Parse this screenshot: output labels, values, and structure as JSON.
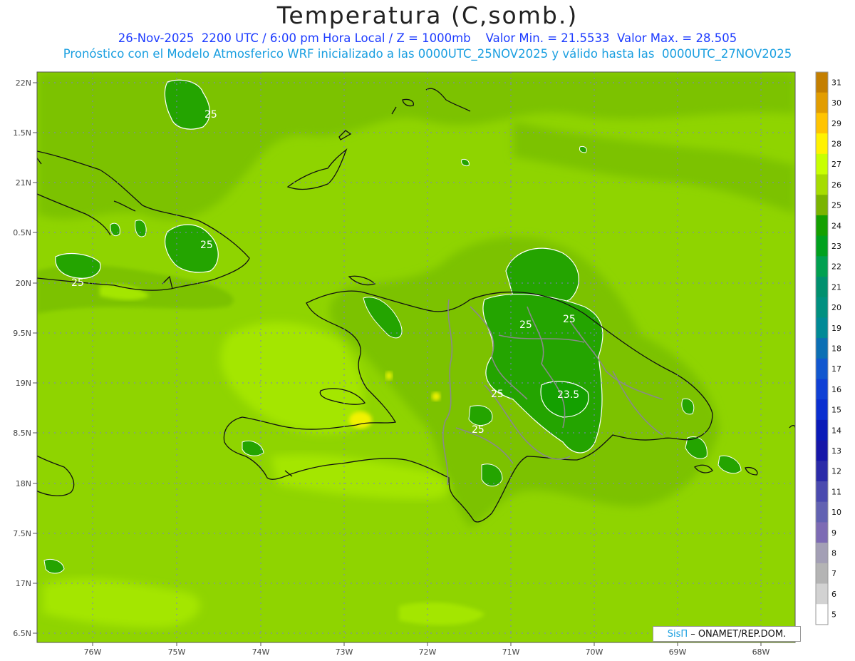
{
  "title": "Temperatura (C,somb.)",
  "subtitle_line1": "26-Nov-2025  2200 UTC / 6:00 pm Hora Local / Z = 1000mb    Valor Min. = 21.5533  Valor Max. = 28.505",
  "subtitle_line2": "Pronóstico con el Modelo Atmosferico WRF inicializado a las 0000UTC_25NOV2025 y válido hasta las  0000UTC_27NOV2025",
  "lat_labels": [
    "22N",
    "1.5N",
    "21N",
    "0.5N",
    "20N",
    "9.5N",
    "19N",
    "8.5N",
    "18N",
    "7.5N",
    "17N",
    "6.5N"
  ],
  "lon_labels": [
    "76W",
    "75W",
    "74W",
    "73W",
    "72W",
    "71W",
    "70W",
    "69W",
    "68W"
  ],
  "colorbar": {
    "labels": [
      "31",
      "30",
      "29",
      "28",
      "27",
      "26",
      "25",
      "24",
      "23",
      "22",
      "21",
      "20",
      "19",
      "18",
      "17",
      "16",
      "15",
      "14",
      "13",
      "12",
      "11",
      "10",
      "9",
      "8",
      "7",
      "6",
      "5"
    ],
    "colors": [
      "#c47f00",
      "#e29d00",
      "#ffc400",
      "#fff200",
      "#c8ff00",
      "#a6dc00",
      "#7ab400",
      "#14a000",
      "#00a11e",
      "#00a050",
      "#00906e",
      "#009080",
      "#008a96",
      "#0b6fb4",
      "#1157cf",
      "#0f40d5",
      "#0a2ed0",
      "#0a1ab8",
      "#1616a8",
      "#2a2aa8",
      "#4a4aaf",
      "#6262b2",
      "#7d6bb4",
      "#a39fb5",
      "#b4b4b4",
      "#d2d2d2",
      "#ffffff"
    ]
  },
  "contour_labels": [
    "25",
    "25",
    "25",
    "25",
    "25",
    "25",
    "25",
    "23.5"
  ],
  "credit": {
    "brand": "SisΠ",
    "text": "– ONAMET/REP.DOM."
  }
}
